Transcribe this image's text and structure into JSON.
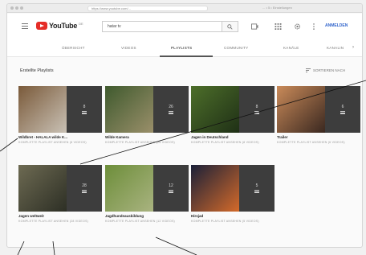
{
  "browser": {
    "url": "https://www.youtube.com/...",
    "right_text": "... • 5 • Einstellungen"
  },
  "header": {
    "logo_word": "YouTube",
    "logo_sup": "DE",
    "search_value": "hatar tv",
    "signin_label": "ANMELDEN",
    "icons": [
      "menu-icon",
      "search-icon",
      "upload-icon",
      "apps-icon",
      "settings-icon",
      "more-icon"
    ]
  },
  "tabs": {
    "items": [
      {
        "label": "ÜBERSICHT"
      },
      {
        "label": "VIDEOS"
      },
      {
        "label": "PLAYLISTS"
      },
      {
        "label": "COMMUNITY"
      },
      {
        "label": "KANÄLE"
      },
      {
        "label": "KANALIN"
      }
    ],
    "active": "PLAYLISTS",
    "more_glyph": "›"
  },
  "section": {
    "title": "Erstellte Playlists",
    "sort_label": "SORTIEREN NACH"
  },
  "playlists": [
    {
      "title": "Wildbret - HALALA wilde K...",
      "count": "8",
      "sub": "KOMPLETTE PLAYLIST ANSEHEN (8 VIDEOS)",
      "colors": [
        "#7a5a3a",
        "#c9c1b5"
      ]
    },
    {
      "title": "Wilde Kamera",
      "count": "26",
      "sub": "KOMPLETTE PLAYLIST ANSEHEN (26 VIDEOS)",
      "colors": [
        "#3f5a2e",
        "#9a8f6a"
      ]
    },
    {
      "title": "Jagen in Deutschland",
      "count": "8",
      "sub": "KOMPLETTE PLAYLIST ANSEHEN (8 VIDEOS)",
      "colors": [
        "#4d6e2a",
        "#1f3016"
      ]
    },
    {
      "title": "Trailer",
      "count": "6",
      "sub": "KOMPLETTE PLAYLIST ANSEHEN (6 VIDEOS)",
      "colors": [
        "#c98a59",
        "#3a2820"
      ]
    },
    {
      "title": "Jagen weltweit",
      "count": "28",
      "sub": "KOMPLETTE PLAYLIST ANSEHEN (28 VIDEOS)",
      "colors": [
        "#6d6a52",
        "#2d2f25"
      ]
    },
    {
      "title": "Jagdhundeausbildung",
      "count": "12",
      "sub": "KOMPLETTE PLAYLIST ANSEHEN (12 VIDEOS)",
      "colors": [
        "#6d8e3a",
        "#a9b380"
      ]
    },
    {
      "title": "Hirsjad",
      "count": "5",
      "sub": "KOMPLETTE PLAYLIST ANSEHEN (5 VIDEOS)",
      "colors": [
        "#1a2038",
        "#d46a2a"
      ]
    }
  ]
}
